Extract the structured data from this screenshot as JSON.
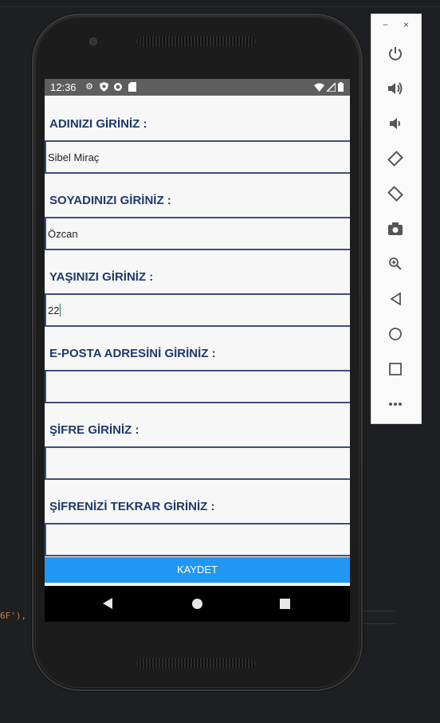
{
  "ide": {
    "code_fragment": "6F'),"
  },
  "statusbar": {
    "time": "12:36"
  },
  "form": {
    "name": {
      "label": "ADINIZI GİRİNİZ :",
      "value": "Sibel Miraç"
    },
    "surname": {
      "label": "SOYADINIZI GİRİNİZ :",
      "value": "Özcan"
    },
    "age": {
      "label": "YAŞINIZI GİRİNİZ :",
      "value": "22"
    },
    "email": {
      "label": "E-POSTA ADRESİNİ GİRİNİZ :",
      "value": ""
    },
    "password": {
      "label": "ŞİFRE GİRİNİZ :",
      "value": ""
    },
    "password_repeat": {
      "label": "ŞİFRENİZİ TEKRAR GİRİNİZ :",
      "value": ""
    },
    "save_label": "KAYDET"
  },
  "emulator_toolbar": {
    "minimize": "−",
    "close": "×",
    "buttons": [
      "power-icon",
      "volume-up-icon",
      "volume-down-icon",
      "rotate-left-icon",
      "rotate-right-icon",
      "camera-icon",
      "zoom-icon",
      "back-icon",
      "home-icon",
      "overview-icon",
      "more-icon"
    ]
  },
  "colors": {
    "label": "#1f3a6b",
    "field_border": "#3b4f80",
    "save_button": "#2196f3",
    "status_bar": "#5e5e5e"
  }
}
